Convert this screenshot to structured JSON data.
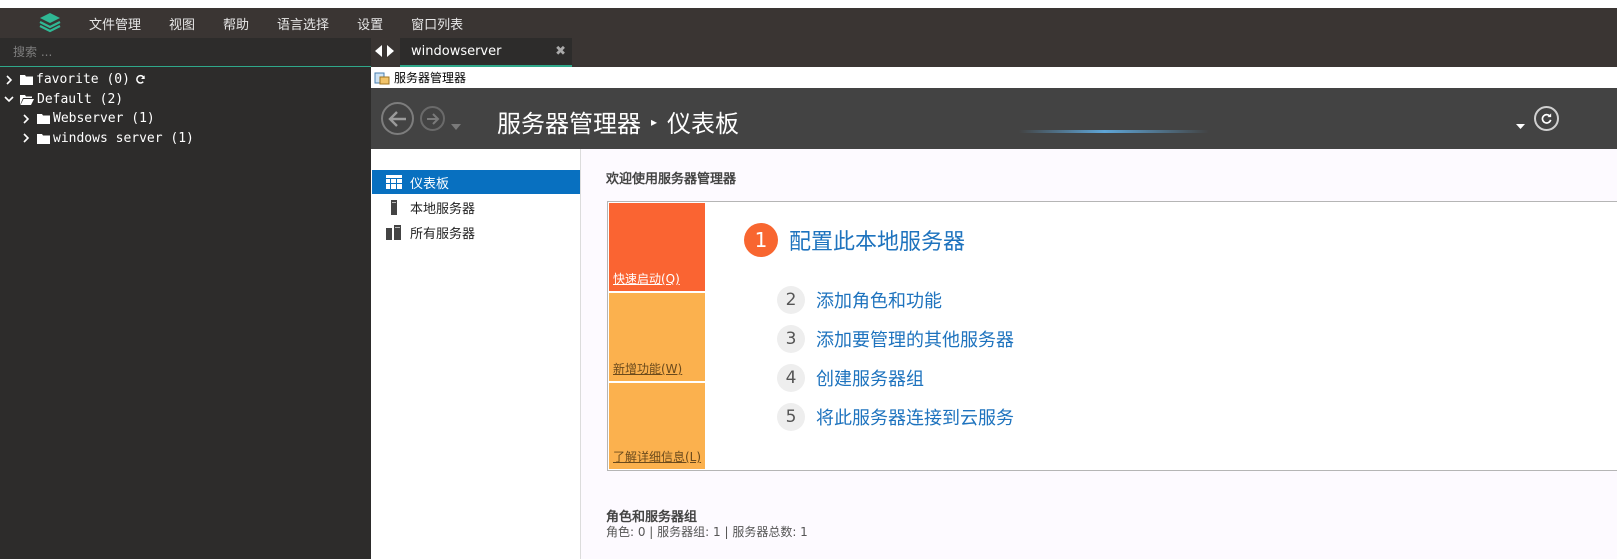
{
  "app": {
    "menu": [
      "文件管理",
      "视图",
      "帮助",
      "语言选择",
      "设置",
      "窗口列表"
    ]
  },
  "sidebar": {
    "search_placeholder": "搜索 ...",
    "tree": [
      {
        "label": "favorite (0)",
        "expanded": false,
        "level": 0,
        "refresh": true
      },
      {
        "label": "Default (2)",
        "expanded": true,
        "level": 0
      },
      {
        "label": "Webserver (1)",
        "expanded": false,
        "level": 1
      },
      {
        "label": "windows server (1)",
        "expanded": false,
        "level": 1
      }
    ]
  },
  "tabs": [
    {
      "label": "windowserver",
      "active": true
    }
  ],
  "remote": {
    "window_title": "服务器管理器",
    "header": {
      "title": "服务器管理器",
      "subtitle": "仪表板"
    },
    "nav": [
      {
        "label": "仪表板",
        "active": true
      },
      {
        "label": "本地服务器",
        "active": false
      },
      {
        "label": "所有服务器",
        "active": false
      }
    ],
    "welcome": "欢迎使用服务器管理器",
    "tiles": [
      "快速启动(Q)",
      "新增功能(W)",
      "了解详细信息(L)"
    ],
    "steps": [
      {
        "num": "1",
        "label": "配置此本地服务器"
      },
      {
        "num": "2",
        "label": "添加角色和功能"
      },
      {
        "num": "3",
        "label": "添加要管理的其他服务器"
      },
      {
        "num": "4",
        "label": "创建服务器组"
      },
      {
        "num": "5",
        "label": "将此服务器连接到云服务"
      }
    ],
    "roles_title": "角色和服务器组",
    "roles_info": "角色: 0 | 服务器组: 1 | 服务器总数: 1"
  },
  "colors": {
    "accent": "#2fa88a",
    "nav_active": "#0870c0",
    "quick_start": "#fa6432",
    "tile_secondary": "#fbb14e",
    "link": "#1e73be"
  },
  "icons": [
    "app-logo-icon",
    "chevron-right-icon",
    "chevron-down-icon",
    "folder-icon",
    "folder-open-icon",
    "refresh-icon",
    "tab-arrows-icon",
    "close-icon",
    "server-manager-icon",
    "back-icon",
    "forward-icon",
    "dashboard-icon",
    "server-icon",
    "servers-icon"
  ]
}
